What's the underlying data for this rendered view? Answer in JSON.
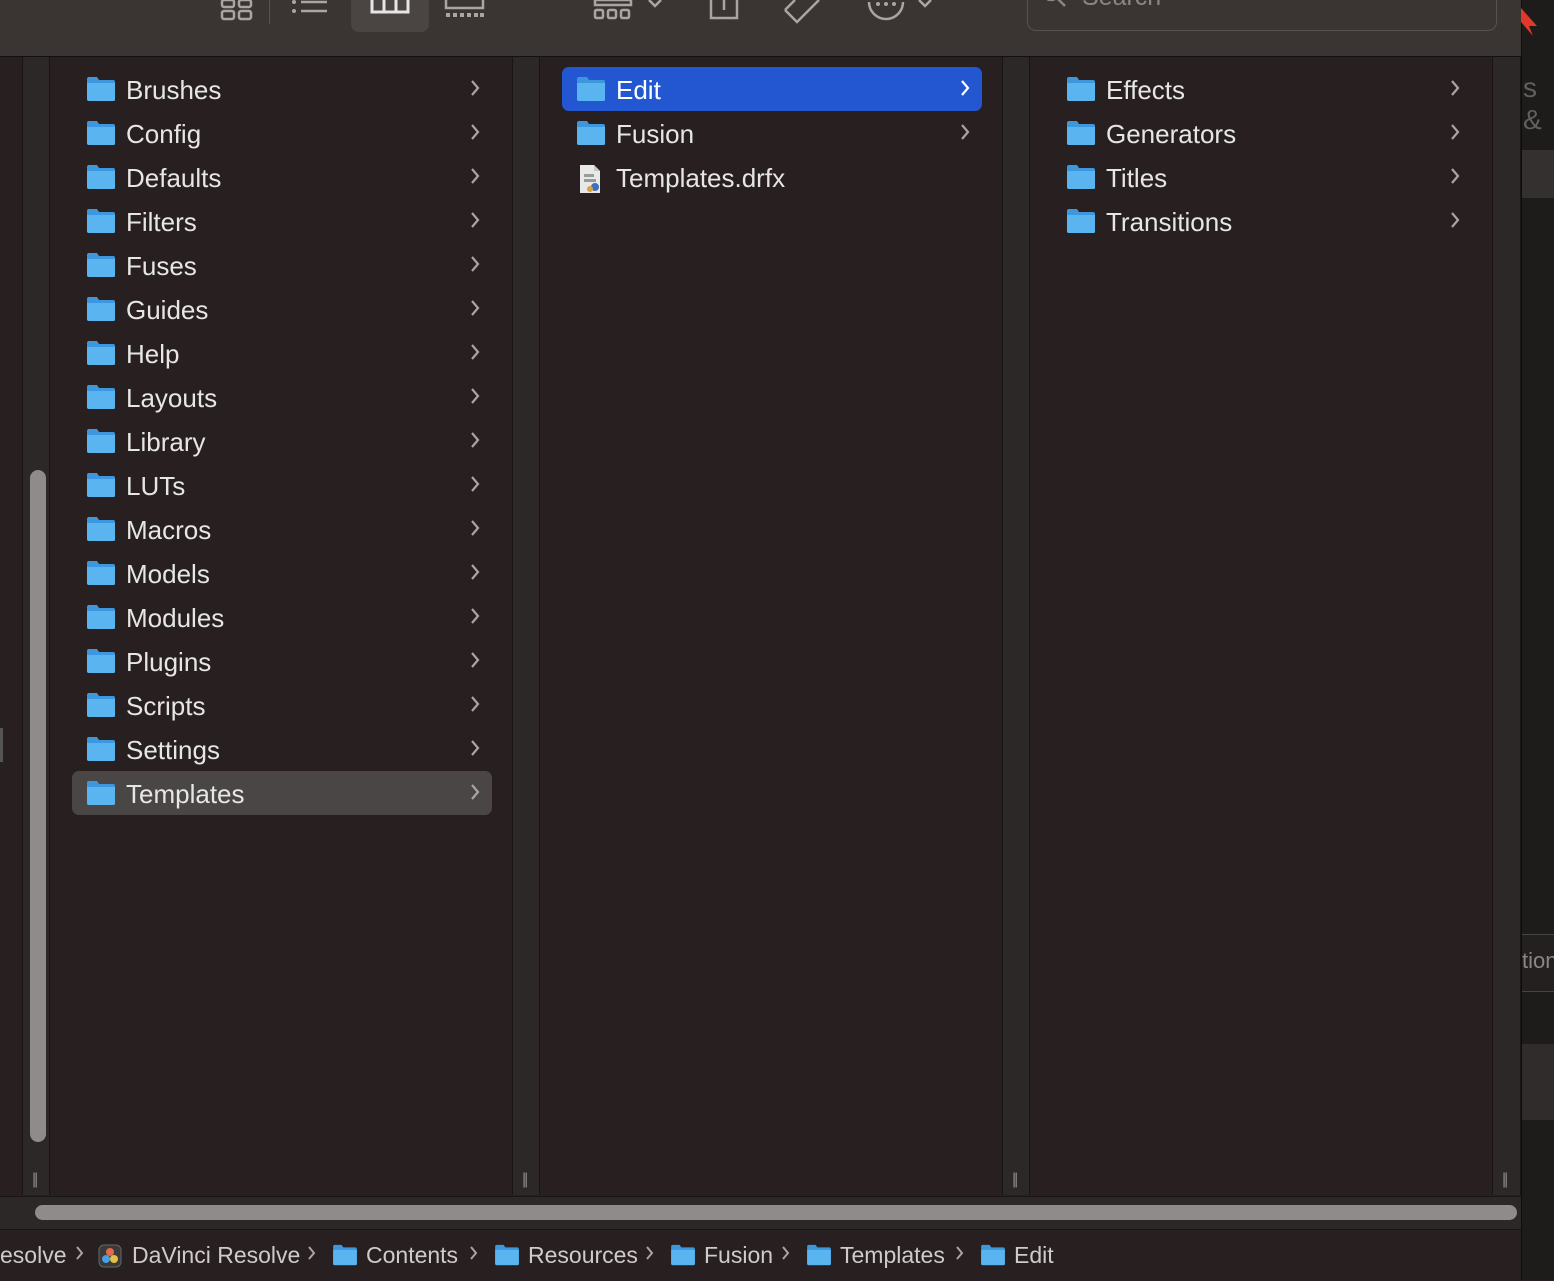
{
  "toolbar": {
    "search_placeholder": "Search",
    "icons": [
      "icon-view-icon",
      "list-view-icon",
      "column-view-icon",
      "gallery-view-icon",
      "group-icon",
      "share-icon",
      "tag-icon",
      "more-icon"
    ]
  },
  "columns": [
    {
      "items": [
        {
          "label": "Brushes",
          "type": "folder"
        },
        {
          "label": "Config",
          "type": "folder"
        },
        {
          "label": "Defaults",
          "type": "folder"
        },
        {
          "label": "Filters",
          "type": "folder"
        },
        {
          "label": "Fuses",
          "type": "folder"
        },
        {
          "label": "Guides",
          "type": "folder"
        },
        {
          "label": "Help",
          "type": "folder"
        },
        {
          "label": "Layouts",
          "type": "folder"
        },
        {
          "label": "Library",
          "type": "folder"
        },
        {
          "label": "LUTs",
          "type": "folder"
        },
        {
          "label": "Macros",
          "type": "folder"
        },
        {
          "label": "Models",
          "type": "folder"
        },
        {
          "label": "Modules",
          "type": "folder"
        },
        {
          "label": "Plugins",
          "type": "folder"
        },
        {
          "label": "Scripts",
          "type": "folder"
        },
        {
          "label": "Settings",
          "type": "folder"
        },
        {
          "label": "Templates",
          "type": "folder",
          "selected": "inactive"
        }
      ]
    },
    {
      "items": [
        {
          "label": "Edit",
          "type": "folder",
          "selected": "active"
        },
        {
          "label": "Fusion",
          "type": "folder"
        },
        {
          "label": "Templates.drfx",
          "type": "file"
        }
      ]
    },
    {
      "items": [
        {
          "label": "Effects",
          "type": "folder"
        },
        {
          "label": "Generators",
          "type": "folder"
        },
        {
          "label": "Titles",
          "type": "folder"
        },
        {
          "label": "Transitions",
          "type": "folder"
        }
      ]
    }
  ],
  "pathbar": {
    "crumbs": [
      "esolve",
      "DaVinci Resolve",
      "Contents",
      "Resources",
      "Fusion",
      "Templates",
      "Edit"
    ]
  },
  "right_strip": {
    "text1": "s &",
    "text2": "tion"
  },
  "colors": {
    "accent": "#2357d2",
    "folder": "#5ab4f0",
    "background": "#282020"
  }
}
